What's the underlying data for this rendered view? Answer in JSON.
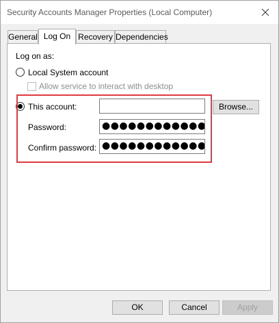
{
  "window": {
    "title": "Security Accounts Manager Properties (Local Computer)"
  },
  "tabs": [
    {
      "label": "General",
      "active": false
    },
    {
      "label": "Log On",
      "active": true
    },
    {
      "label": "Recovery",
      "active": false
    },
    {
      "label": "Dependencies",
      "active": false
    }
  ],
  "logon": {
    "group_label": "Log on as:",
    "local_system_label": "Local System account",
    "allow_interact_label": "Allow service to interact with desktop",
    "this_account_label": "This account:",
    "this_account_value": "",
    "password_label": "Password:",
    "password_value": "●●●●●●●●●●●●●●●",
    "confirm_label": "Confirm password:",
    "confirm_value": "●●●●●●●●●●●●●●●",
    "browse_label": "Browse...",
    "selected": "this_account"
  },
  "footer": {
    "ok_label": "OK",
    "cancel_label": "Cancel",
    "apply_label": "Apply"
  },
  "colors": {
    "highlight": "#e0393e",
    "panel_bg": "#ffffff",
    "window_bg": "#f0f0f0"
  }
}
